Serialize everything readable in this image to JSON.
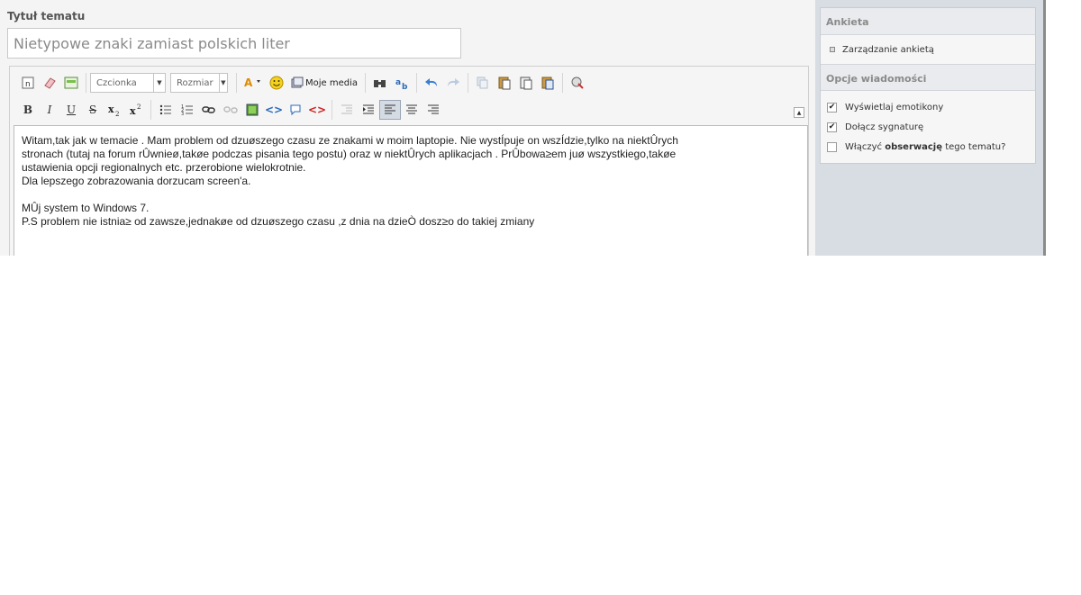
{
  "form": {
    "title_label": "Tytuł tematu",
    "title_value": "Nietypowe znaki zamiast polskich liter"
  },
  "toolbar": {
    "font_combo": "Czcionka",
    "size_combo": "Rozmiar",
    "media_label": "Moje media"
  },
  "editor_lines": [
    "Witam,tak jak w temacie . Mam problem od dzuøszego czasu ze znakami w moim laptopie. Nie wystÍpuje on wszÍdzie,tylko na niektÛrych",
    "stronach (tutaj na forum rÛwnieø,takøe podczas pisania tego postu) oraz w niektÛrych aplikacjach . PrÛbowa≥em juø wszystkiego,takøe",
    "ustawienia opcji regionalnych etc. przerobione wielokrotnie.",
    "Dla lepszego zobrazowania dorzucam screen'a.",
    "",
    "MÛj system to Windows 7.",
    "P.S problem nie istnia≥ od zawsze,jednakøe od dzuøszego czasu ,z dnia na dzieÒ dosz≥o do takiej zmiany"
  ],
  "sidebar": {
    "poll_title": "Ankieta",
    "poll_manage": "Zarządzanie ankietą",
    "options_title": "Opcje wiadomości",
    "opt_emoticons": "Wyświetlaj emotikony",
    "opt_signature": "Dołącz sygnaturę",
    "opt_watch_pre": "Włączyć ",
    "opt_watch_bold": "obserwację",
    "opt_watch_post": " tego tematu?"
  }
}
